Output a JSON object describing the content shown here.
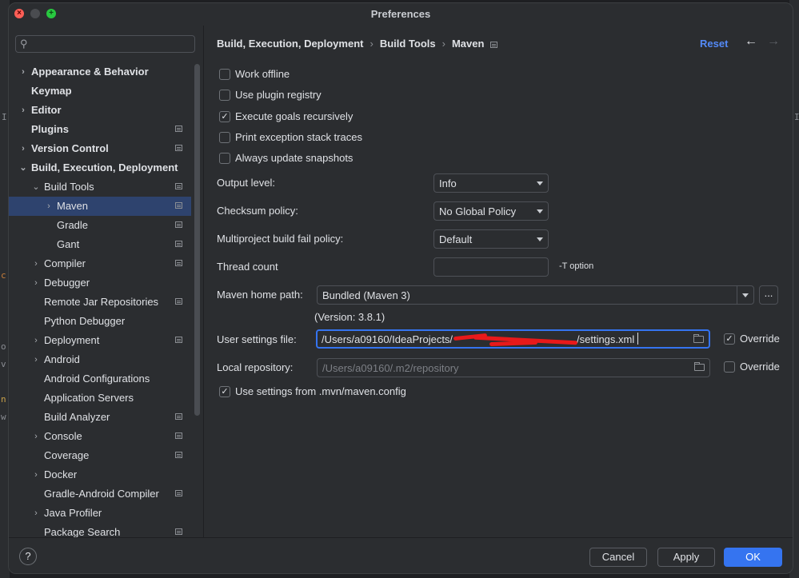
{
  "window": {
    "title": "Preferences"
  },
  "colors": {
    "accent": "#3574f0",
    "selection": "#2e436e",
    "link": "#548af7",
    "panel": "#2b2d30"
  },
  "background_glyphs": [
    "I",
    "I",
    "c",
    "o",
    "v",
    "n",
    "w"
  ],
  "search": {
    "placeholder": "",
    "icon": "search-icon"
  },
  "sidebar": {
    "items": [
      {
        "label": "Appearance & Behavior"
      },
      {
        "label": "Keymap"
      },
      {
        "label": "Editor"
      },
      {
        "label": "Plugins"
      },
      {
        "label": "Version Control"
      },
      {
        "label": "Build, Execution, Deployment"
      },
      {
        "label": "Build Tools"
      },
      {
        "label": "Maven"
      },
      {
        "label": "Gradle"
      },
      {
        "label": "Gant"
      },
      {
        "label": "Compiler"
      },
      {
        "label": "Debugger"
      },
      {
        "label": "Remote Jar Repositories"
      },
      {
        "label": "Python Debugger"
      },
      {
        "label": "Deployment"
      },
      {
        "label": "Android"
      },
      {
        "label": "Android Configurations"
      },
      {
        "label": "Application Servers"
      },
      {
        "label": "Build Analyzer"
      },
      {
        "label": "Console"
      },
      {
        "label": "Coverage"
      },
      {
        "label": "Docker"
      },
      {
        "label": "Gradle-Android Compiler"
      },
      {
        "label": "Java Profiler"
      },
      {
        "label": "Package Search"
      }
    ]
  },
  "breadcrumb": {
    "items": [
      "Build, Execution, Deployment",
      "Build Tools",
      "Maven"
    ],
    "separator": "›"
  },
  "header": {
    "reset": "Reset",
    "back": "←",
    "forward": "→"
  },
  "checkboxes": [
    {
      "label": "Work offline",
      "checked": false
    },
    {
      "label": "Use plugin registry",
      "checked": false
    },
    {
      "label": "Execute goals recursively",
      "checked": true
    },
    {
      "label": "Print exception stack traces",
      "checked": false
    },
    {
      "label": "Always update snapshots",
      "checked": false
    }
  ],
  "check_mark": "✓",
  "fields": {
    "output_level": {
      "label": "Output level:",
      "value": "Info"
    },
    "checksum_policy": {
      "label": "Checksum policy:",
      "value": "No Global Policy"
    },
    "fail_policy": {
      "label": "Multiproject build fail policy:",
      "value": "Default"
    },
    "thread_count": {
      "label": "Thread count",
      "value": "",
      "hint": "-T option"
    },
    "maven_home": {
      "label": "Maven home path:",
      "value": "Bundled (Maven 3)",
      "browse": "...",
      "version": "(Version: 3.8.1)"
    },
    "user_settings": {
      "label": "User settings file:",
      "value_start": "/Users/a09160/IdeaProjects/",
      "value_end": "/settings.xml",
      "override_label": "Override",
      "override_checked": true
    },
    "local_repo": {
      "label": "Local repository:",
      "value": "/Users/a09160/.m2/repository",
      "override_label": "Override",
      "override_checked": false
    },
    "use_mvn_config": {
      "label": "Use settings from .mvn/maven.config",
      "checked": true
    }
  },
  "footer": {
    "help": "?",
    "cancel": "Cancel",
    "apply": "Apply",
    "ok": "OK"
  }
}
